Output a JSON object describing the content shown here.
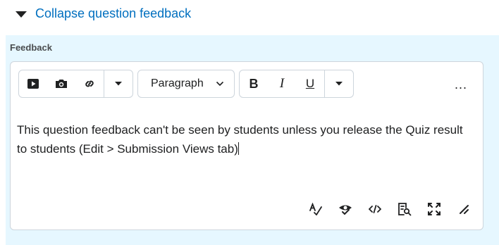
{
  "toggle": {
    "label": "Collapse question feedback"
  },
  "feedback": {
    "label": "Feedback",
    "format_select": "Paragraph",
    "bold_label": "B",
    "italic_label": "I",
    "underline_label": "U",
    "more_label": "...",
    "content": "This question feedback can't be seen by students unless you release the Quiz result to students (Edit > Submission Views tab)"
  },
  "icons": [
    "caret-down-icon",
    "video-icon",
    "camera-icon",
    "link-icon",
    "chevron-down-icon",
    "spellcheck-icon",
    "accessibility-check-icon",
    "source-code-icon",
    "preview-icon",
    "fullscreen-icon",
    "resize-handle-icon"
  ],
  "colors": {
    "link": "#006fbf",
    "panel_bg": "#e6f7ff",
    "border": "#cdd5dc",
    "text": "#202122"
  }
}
